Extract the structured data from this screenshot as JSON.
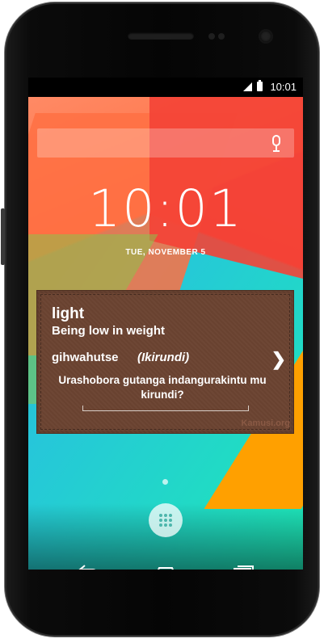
{
  "status_bar": {
    "time": "10:01"
  },
  "lockscreen": {
    "clock": "10:01",
    "date": "TUE, NOVEMBER 5"
  },
  "widget": {
    "word": "light",
    "definition": "Being low in weight",
    "translation": "gihwahutse",
    "language": "(Ikirundi)",
    "question": "Urashobora gutanga indangurakintu mu kirundi?",
    "brand": "Kamusi.org"
  },
  "icons": {
    "search": "search-bar",
    "mic": "mic-icon",
    "chevron": "chevron-right-icon",
    "app_drawer": "app-drawer-icon",
    "back": "back-icon",
    "home": "home-icon",
    "recents": "recents-icon"
  },
  "colors": {
    "widget_bg": "#6b4331",
    "brand_text": "#8a5a45"
  }
}
